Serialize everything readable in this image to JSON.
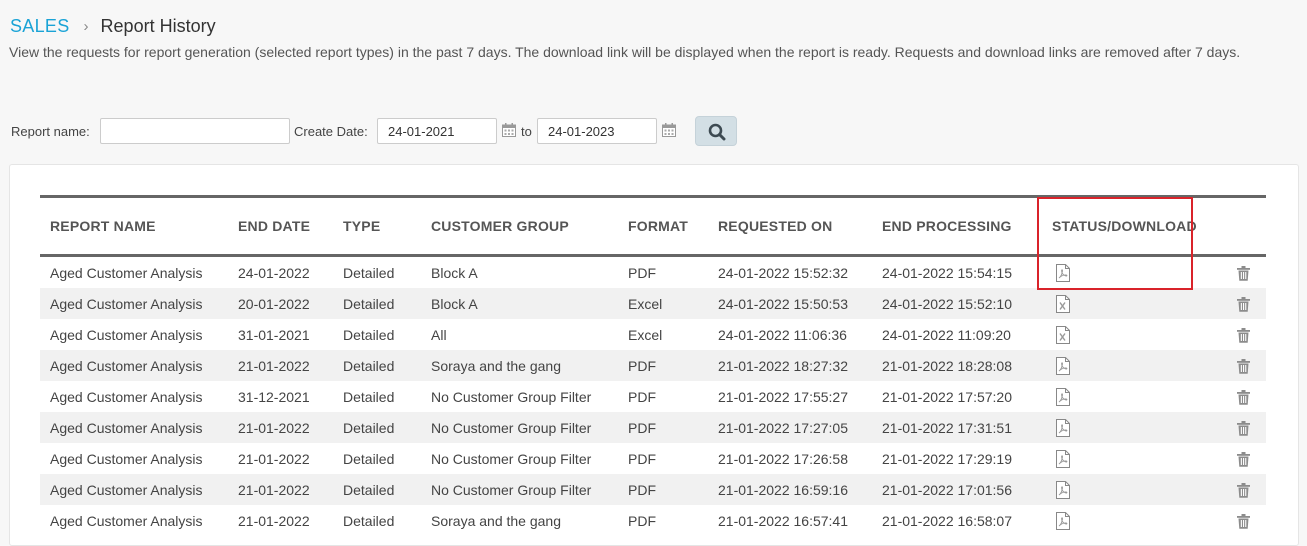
{
  "breadcrumb": {
    "root": "SALES",
    "separator": "›",
    "current": "Report History"
  },
  "description": "View the requests for report generation (selected report types) in the past 7 days. The download link will be displayed when the report is ready. Requests and download links are removed after 7 days.",
  "filters": {
    "report_name_label": "Report name:",
    "report_name_value": "",
    "create_date_label": "Create Date:",
    "from_date": "24-01-2021",
    "to_label": "to",
    "to_date": "24-01-2023",
    "search_icon": "search-icon",
    "calendar_icon": "calendar-icon"
  },
  "table": {
    "headers": [
      "REPORT NAME",
      "END DATE",
      "TYPE",
      "CUSTOMER GROUP",
      "FORMAT",
      "REQUESTED ON",
      "END PROCESSING",
      "STATUS/DOWNLOAD"
    ],
    "rows": [
      {
        "report_name": "Aged Customer Analysis",
        "end_date": "24-01-2022",
        "type": "Detailed",
        "customer_group": "Block A",
        "format": "PDF",
        "requested_on": "24-01-2022 15:52:32",
        "end_processing": "24-01-2022 15:54:15",
        "download_icon": "pdf-file-icon"
      },
      {
        "report_name": "Aged Customer Analysis",
        "end_date": "20-01-2022",
        "type": "Detailed",
        "customer_group": "Block A",
        "format": "Excel",
        "requested_on": "24-01-2022 15:50:53",
        "end_processing": "24-01-2022 15:52:10",
        "download_icon": "excel-file-icon"
      },
      {
        "report_name": "Aged Customer Analysis",
        "end_date": "31-01-2021",
        "type": "Detailed",
        "customer_group": "All",
        "format": "Excel",
        "requested_on": "24-01-2022 11:06:36",
        "end_processing": "24-01-2022 11:09:20",
        "download_icon": "excel-file-icon"
      },
      {
        "report_name": "Aged Customer Analysis",
        "end_date": "21-01-2022",
        "type": "Detailed",
        "customer_group": "Soraya and the gang",
        "format": "PDF",
        "requested_on": "21-01-2022 18:27:32",
        "end_processing": "21-01-2022 18:28:08",
        "download_icon": "pdf-file-icon"
      },
      {
        "report_name": "Aged Customer Analysis",
        "end_date": "31-12-2021",
        "type": "Detailed",
        "customer_group": "No Customer Group Filter",
        "format": "PDF",
        "requested_on": "21-01-2022 17:55:27",
        "end_processing": "21-01-2022 17:57:20",
        "download_icon": "pdf-file-icon"
      },
      {
        "report_name": "Aged Customer Analysis",
        "end_date": "21-01-2022",
        "type": "Detailed",
        "customer_group": "No Customer Group Filter",
        "format": "PDF",
        "requested_on": "21-01-2022 17:27:05",
        "end_processing": "21-01-2022 17:31:51",
        "download_icon": "pdf-file-icon"
      },
      {
        "report_name": "Aged Customer Analysis",
        "end_date": "21-01-2022",
        "type": "Detailed",
        "customer_group": "No Customer Group Filter",
        "format": "PDF",
        "requested_on": "21-01-2022 17:26:58",
        "end_processing": "21-01-2022 17:29:19",
        "download_icon": "pdf-file-icon"
      },
      {
        "report_name": "Aged Customer Analysis",
        "end_date": "21-01-2022",
        "type": "Detailed",
        "customer_group": "No Customer Group Filter",
        "format": "PDF",
        "requested_on": "21-01-2022 16:59:16",
        "end_processing": "21-01-2022 17:01:56",
        "download_icon": "pdf-file-icon"
      },
      {
        "report_name": "Aged Customer Analysis",
        "end_date": "21-01-2022",
        "type": "Detailed",
        "customer_group": "Soraya and the gang",
        "format": "PDF",
        "requested_on": "21-01-2022 16:57:41",
        "end_processing": "21-01-2022 16:58:07",
        "download_icon": "pdf-file-icon"
      }
    ],
    "delete_icon": "trash-icon"
  },
  "colors": {
    "accent": "#1aa3d6",
    "highlight_border": "#d9232a",
    "search_button_bg": "#d3dfe5",
    "row_alt_bg": "#f1f1f1"
  }
}
